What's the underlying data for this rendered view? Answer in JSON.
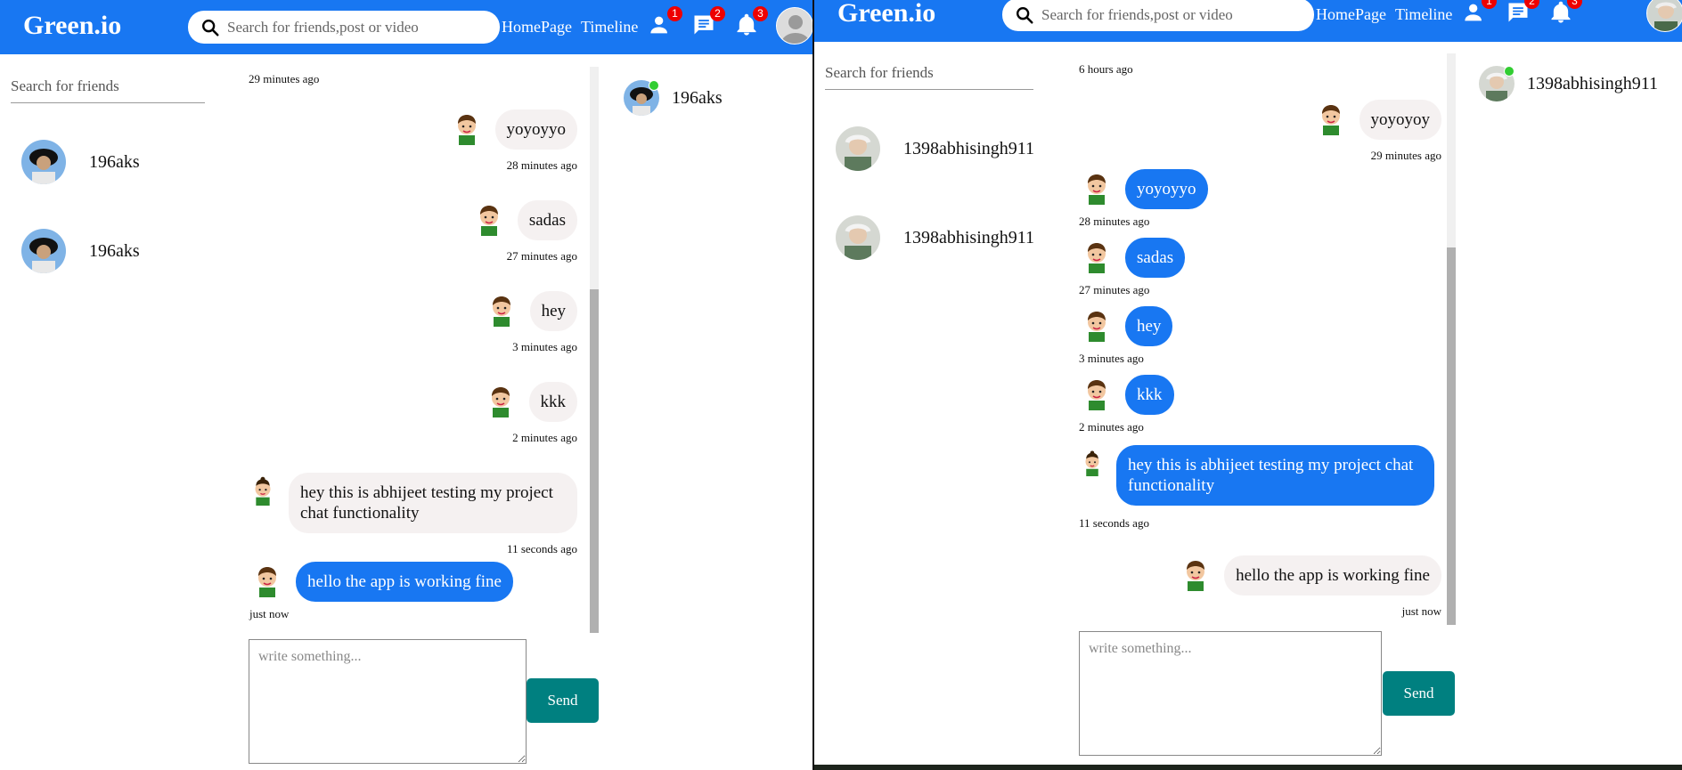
{
  "header": {
    "logo": "Green.io",
    "search_placeholder": "Search for friends,post or video",
    "homepage": "HomePage",
    "timeline": "Timeline",
    "badge_person": "1",
    "badge_chat": "2",
    "badge_bell": "3"
  },
  "colors": {
    "brand": "#1877f2",
    "send": "#008080",
    "online": "#32cd32",
    "badge": "#ee0000"
  },
  "left_window": {
    "friend_search_placeholder": "Search for friends",
    "conversations": [
      {
        "name": "196aks"
      },
      {
        "name": "196aks"
      }
    ],
    "online_friends": [
      {
        "name": "196aks"
      }
    ],
    "top_time": "29 minutes ago",
    "messages": [
      {
        "text": "yoyoyyo",
        "time": "28 minutes ago",
        "own": true
      },
      {
        "text": "sadas",
        "time": "27 minutes ago",
        "own": true
      },
      {
        "text": "hey",
        "time": "3 minutes ago",
        "own": true
      },
      {
        "text": "kkk",
        "time": "2 minutes ago",
        "own": true
      },
      {
        "text": "hey this is abhijeet testing my project chat functionality",
        "time": "11 seconds ago",
        "own": true
      },
      {
        "text": "hello the app is working fine",
        "time": "just now",
        "own": false
      }
    ],
    "composer_placeholder": "write something...",
    "send_label": "Send"
  },
  "right_window": {
    "friend_search_placeholder": "Search for friends",
    "conversations": [
      {
        "name": "1398abhisingh911"
      },
      {
        "name": "1398abhisingh911"
      }
    ],
    "online_friends": [
      {
        "name": "1398abhisingh911"
      }
    ],
    "top_time": "6 hours ago",
    "messages": [
      {
        "text": "yoyoyoy",
        "time": "29 minutes ago",
        "own": true
      },
      {
        "text": "yoyoyyo",
        "time": "28 minutes ago",
        "own": false
      },
      {
        "text": "sadas",
        "time": "27 minutes ago",
        "own": false
      },
      {
        "text": "hey",
        "time": "3 minutes ago",
        "own": false
      },
      {
        "text": "kkk",
        "time": "2 minutes ago",
        "own": false
      },
      {
        "text": "hey this is abhijeet testing my project chat functionality",
        "time": "11 seconds ago",
        "own": false
      },
      {
        "text": "hello the app is working fine",
        "time": "just now",
        "own": true
      }
    ],
    "composer_placeholder": "write something...",
    "send_label": "Send"
  }
}
